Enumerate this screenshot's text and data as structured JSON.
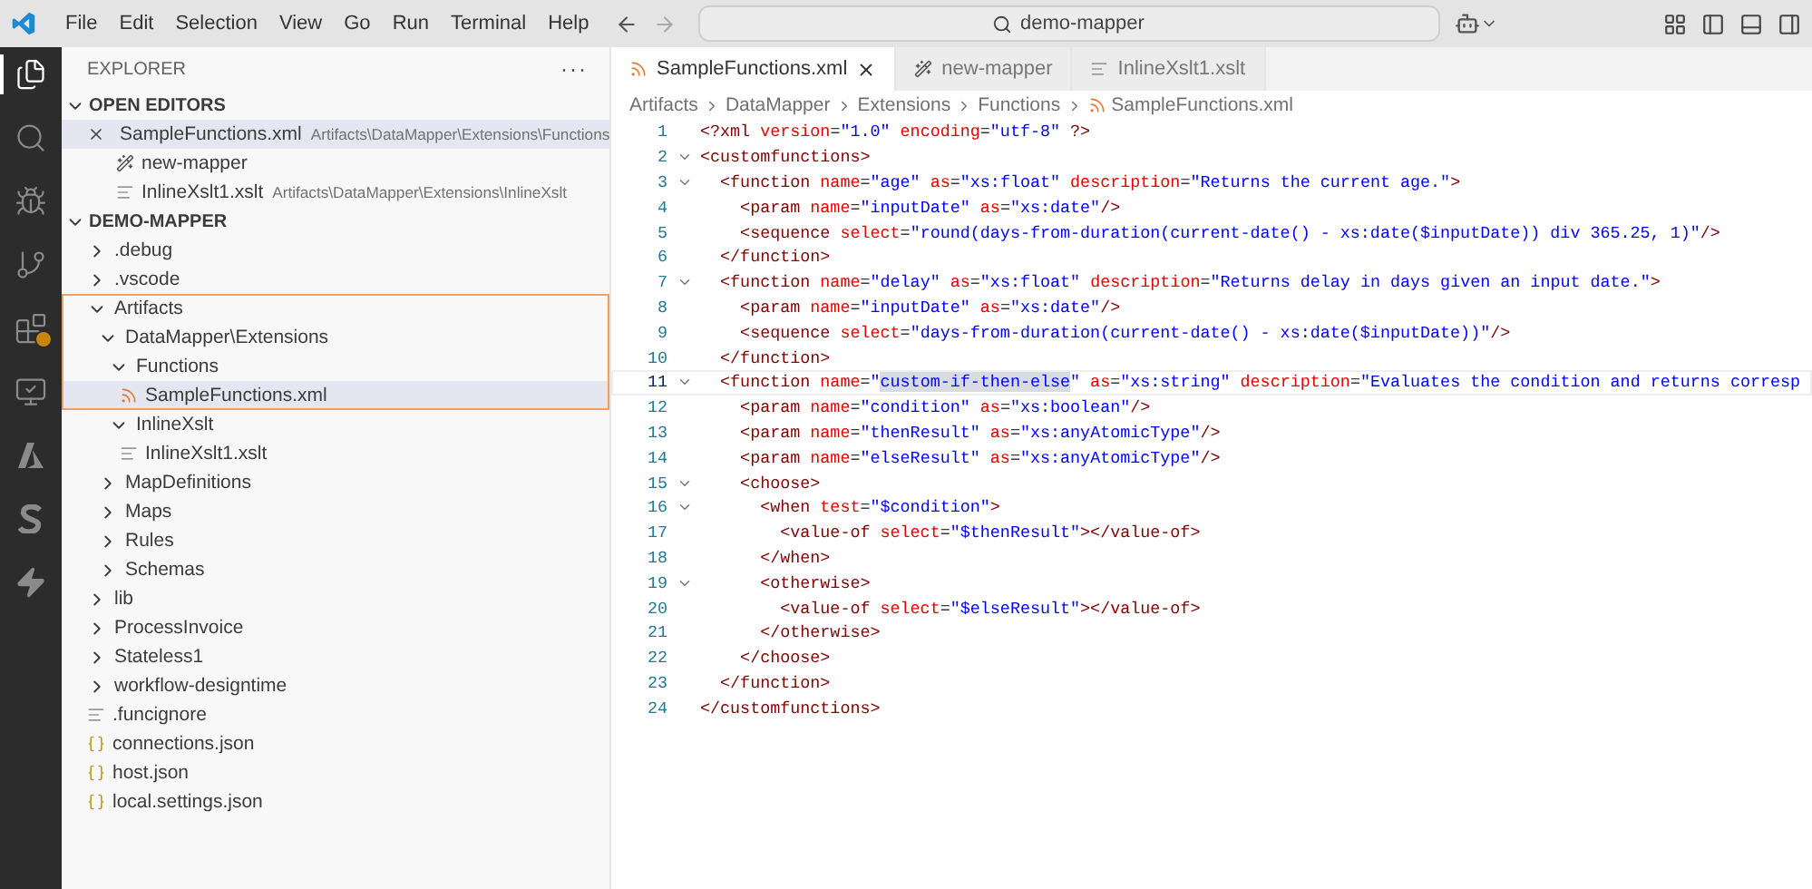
{
  "title_bar": {
    "menu": [
      "File",
      "Edit",
      "Selection",
      "View",
      "Go",
      "Run",
      "Terminal",
      "Help"
    ],
    "search": {
      "value": "demo-mapper"
    }
  },
  "activity_bar": [
    {
      "kind": "explorer",
      "selected": true
    },
    {
      "kind": "search",
      "selected": false
    },
    {
      "kind": "debug",
      "selected": false
    },
    {
      "kind": "git",
      "selected": false
    },
    {
      "kind": "extensions",
      "selected": false,
      "warning": true
    },
    {
      "kind": "remote",
      "selected": false
    },
    {
      "kind": "azure",
      "selected": false
    },
    {
      "kind": "sync",
      "selected": false
    },
    {
      "kind": "bolt",
      "selected": false
    }
  ],
  "explorer": {
    "title": "EXPLORER",
    "more": "···",
    "open_editors": {
      "title": "OPEN EDITORS",
      "expanded": true,
      "items": [
        {
          "name": "SampleFunctions.xml",
          "path": "Artifacts\\DataMapper\\Extensions\\Functions",
          "kind": "xml-file",
          "selected": true
        },
        {
          "name": "new-mapper",
          "kind": "mapper",
          "selected": false
        },
        {
          "name": "InlineXslt1.xslt",
          "path": "Artifacts\\DataMapper\\Extensions\\InlineXslt",
          "kind": "text-file",
          "selected": false
        }
      ]
    },
    "workspace": {
      "title": "DEMO-MAPPER",
      "expanded": true,
      "items": [
        {
          "name": ".debug",
          "kind": "folder",
          "expanded": false,
          "selected": false,
          "framed": false
        },
        {
          "name": ".vscode",
          "kind": "folder",
          "expanded": false,
          "selected": false,
          "framed": false
        },
        {
          "name": "Artifacts",
          "kind": "folder",
          "expanded": true,
          "selected": false,
          "framed": true,
          "children": [
            {
              "name": "DataMapper\\Extensions",
              "kind": "folder",
              "expanded": true,
              "selected": false,
              "framed": true,
              "children": [
                {
                  "name": "Functions",
                  "kind": "folder",
                  "expanded": true,
                  "selected": false,
                  "framed": true,
                  "children": [
                    {
                      "name": "SampleFunctions.xml",
                      "kind": "xml-file",
                      "selected": true,
                      "framed": true
                    }
                  ]
                },
                {
                  "name": "InlineXslt",
                  "kind": "folder",
                  "expanded": true,
                  "selected": false,
                  "framed": false,
                  "children": [
                    {
                      "name": "InlineXslt1.xslt",
                      "kind": "text-file",
                      "selected": false,
                      "framed": false
                    }
                  ]
                }
              ]
            },
            {
              "name": "MapDefinitions",
              "kind": "folder",
              "expanded": false,
              "selected": false,
              "framed": false
            },
            {
              "name": "Maps",
              "kind": "folder",
              "expanded": false,
              "selected": false,
              "framed": false
            },
            {
              "name": "Rules",
              "kind": "folder",
              "expanded": false,
              "selected": false,
              "framed": false
            },
            {
              "name": "Schemas",
              "kind": "folder",
              "expanded": false,
              "selected": false,
              "framed": false
            }
          ]
        },
        {
          "name": "lib",
          "kind": "folder",
          "expanded": false,
          "selected": false,
          "framed": false
        },
        {
          "name": "ProcessInvoice",
          "kind": "folder",
          "expanded": false,
          "selected": false,
          "framed": false
        },
        {
          "name": "Stateless1",
          "kind": "folder",
          "expanded": false,
          "selected": false,
          "framed": false
        },
        {
          "name": "workflow-designtime",
          "kind": "folder",
          "expanded": false,
          "selected": false,
          "framed": false
        },
        {
          "name": ".funcignore",
          "kind": "text-file",
          "selected": false,
          "framed": false
        },
        {
          "name": "connections.json",
          "kind": "json-file",
          "selected": false,
          "framed": false
        },
        {
          "name": "host.json",
          "kind": "json-file",
          "selected": false,
          "framed": false
        },
        {
          "name": "local.settings.json",
          "kind": "json-file",
          "selected": false,
          "framed": false
        }
      ]
    }
  },
  "tabs": [
    {
      "label": "SampleFunctions.xml",
      "kind": "xml-file",
      "selected": true
    },
    {
      "label": "new-mapper",
      "kind": "mapper",
      "selected": false
    },
    {
      "label": "InlineXslt1.xslt",
      "kind": "text-file",
      "selected": false
    }
  ],
  "breadcrumb": [
    {
      "label": "Artifacts",
      "kind": "folder"
    },
    {
      "label": "DataMapper",
      "kind": "folder"
    },
    {
      "label": "Extensions",
      "kind": "folder"
    },
    {
      "label": "Functions",
      "kind": "folder"
    },
    {
      "label": "SampleFunctions.xml",
      "kind": "xml-file"
    }
  ],
  "code": [
    {
      "number": "1",
      "foldable": false,
      "current": false,
      "tokens": [
        {
          "kind": "tag",
          "text": "<?xml"
        },
        {
          "kind": "attr",
          "text": " version"
        },
        {
          "kind": "punct",
          "text": "="
        },
        {
          "kind": "value",
          "text": "\"1.0\""
        },
        {
          "kind": "attr",
          "text": " encoding"
        },
        {
          "kind": "punct",
          "text": "="
        },
        {
          "kind": "value",
          "text": "\"utf-8\""
        },
        {
          "kind": "tag",
          "text": " ?>"
        }
      ]
    },
    {
      "number": "2",
      "foldable": true,
      "current": false,
      "tokens": [
        {
          "kind": "tag",
          "text": "<customfunctions>"
        }
      ]
    },
    {
      "number": "3",
      "foldable": true,
      "current": false,
      "tokens": [
        {
          "kind": "tag",
          "text": "  <function"
        },
        {
          "kind": "attr",
          "text": " name"
        },
        {
          "kind": "punct",
          "text": "="
        },
        {
          "kind": "value",
          "text": "\"age\""
        },
        {
          "kind": "attr",
          "text": " as"
        },
        {
          "kind": "punct",
          "text": "="
        },
        {
          "kind": "value",
          "text": "\"xs:float\""
        },
        {
          "kind": "attr",
          "text": " description"
        },
        {
          "kind": "punct",
          "text": "="
        },
        {
          "kind": "value",
          "text": "\"Returns the current age.\""
        },
        {
          "kind": "tag",
          "text": ">"
        }
      ]
    },
    {
      "number": "4",
      "foldable": false,
      "current": false,
      "tokens": [
        {
          "kind": "tag",
          "text": "    <param"
        },
        {
          "kind": "attr",
          "text": " name"
        },
        {
          "kind": "punct",
          "text": "="
        },
        {
          "kind": "value",
          "text": "\"inputDate\""
        },
        {
          "kind": "attr",
          "text": " as"
        },
        {
          "kind": "punct",
          "text": "="
        },
        {
          "kind": "value",
          "text": "\"xs:date\""
        },
        {
          "kind": "tag",
          "text": "/>"
        }
      ]
    },
    {
      "number": "5",
      "foldable": false,
      "current": false,
      "tokens": [
        {
          "kind": "tag",
          "text": "    <sequence"
        },
        {
          "kind": "attr",
          "text": " select"
        },
        {
          "kind": "punct",
          "text": "="
        },
        {
          "kind": "value",
          "text": "\"round(days-from-duration(current-date() - xs:date($inputDate)) div 365.25, 1)\""
        },
        {
          "kind": "tag",
          "text": "/>"
        }
      ]
    },
    {
      "number": "6",
      "foldable": false,
      "current": false,
      "tokens": [
        {
          "kind": "tag",
          "text": "  </function>"
        }
      ]
    },
    {
      "number": "7",
      "foldable": true,
      "current": false,
      "tokens": [
        {
          "kind": "tag",
          "text": "  <function"
        },
        {
          "kind": "attr",
          "text": " name"
        },
        {
          "kind": "punct",
          "text": "="
        },
        {
          "kind": "value",
          "text": "\"delay\""
        },
        {
          "kind": "attr",
          "text": " as"
        },
        {
          "kind": "punct",
          "text": "="
        },
        {
          "kind": "value",
          "text": "\"xs:float\""
        },
        {
          "kind": "attr",
          "text": " description"
        },
        {
          "kind": "punct",
          "text": "="
        },
        {
          "kind": "value",
          "text": "\"Returns delay in days given an input date.\""
        },
        {
          "kind": "tag",
          "text": ">"
        }
      ]
    },
    {
      "number": "8",
      "foldable": false,
      "current": false,
      "tokens": [
        {
          "kind": "tag",
          "text": "    <param"
        },
        {
          "kind": "attr",
          "text": " name"
        },
        {
          "kind": "punct",
          "text": "="
        },
        {
          "kind": "value",
          "text": "\"inputDate\""
        },
        {
          "kind": "attr",
          "text": " as"
        },
        {
          "kind": "punct",
          "text": "="
        },
        {
          "kind": "value",
          "text": "\"xs:date\""
        },
        {
          "kind": "tag",
          "text": "/>"
        }
      ]
    },
    {
      "number": "9",
      "foldable": false,
      "current": false,
      "tokens": [
        {
          "kind": "tag",
          "text": "    <sequence"
        },
        {
          "kind": "attr",
          "text": " select"
        },
        {
          "kind": "punct",
          "text": "="
        },
        {
          "kind": "value",
          "text": "\"days-from-duration(current-date() - xs:date($inputDate))\""
        },
        {
          "kind": "tag",
          "text": "/>"
        }
      ]
    },
    {
      "number": "10",
      "foldable": false,
      "current": false,
      "tokens": [
        {
          "kind": "tag",
          "text": "  </function>"
        }
      ]
    },
    {
      "number": "11",
      "foldable": true,
      "current": true,
      "tokens": [
        {
          "kind": "tag",
          "text": "  <function"
        },
        {
          "kind": "attr",
          "text": " name"
        },
        {
          "kind": "punct",
          "text": "="
        },
        {
          "kind": "value",
          "text": "\""
        },
        {
          "kind": "selected-value",
          "text": "custom-if-then-else"
        },
        {
          "kind": "value",
          "text": "\""
        },
        {
          "kind": "attr",
          "text": " as"
        },
        {
          "kind": "punct",
          "text": "="
        },
        {
          "kind": "value",
          "text": "\"xs:string\""
        },
        {
          "kind": "attr",
          "text": " description"
        },
        {
          "kind": "punct",
          "text": "="
        },
        {
          "kind": "value",
          "text": "\"Evaluates the condition and returns corresp"
        }
      ]
    },
    {
      "number": "12",
      "foldable": false,
      "current": false,
      "tokens": [
        {
          "kind": "tag",
          "text": "    <param"
        },
        {
          "kind": "attr",
          "text": " name"
        },
        {
          "kind": "punct",
          "text": "="
        },
        {
          "kind": "value",
          "text": "\"condition\""
        },
        {
          "kind": "attr",
          "text": " as"
        },
        {
          "kind": "punct",
          "text": "="
        },
        {
          "kind": "value",
          "text": "\"xs:boolean\""
        },
        {
          "kind": "tag",
          "text": "/>"
        }
      ]
    },
    {
      "number": "13",
      "foldable": false,
      "current": false,
      "tokens": [
        {
          "kind": "tag",
          "text": "    <param"
        },
        {
          "kind": "attr",
          "text": " name"
        },
        {
          "kind": "punct",
          "text": "="
        },
        {
          "kind": "value",
          "text": "\"thenResult\""
        },
        {
          "kind": "attr",
          "text": " as"
        },
        {
          "kind": "punct",
          "text": "="
        },
        {
          "kind": "value",
          "text": "\"xs:anyAtomicType\""
        },
        {
          "kind": "tag",
          "text": "/>"
        }
      ]
    },
    {
      "number": "14",
      "foldable": false,
      "current": false,
      "tokens": [
        {
          "kind": "tag",
          "text": "    <param"
        },
        {
          "kind": "attr",
          "text": " name"
        },
        {
          "kind": "punct",
          "text": "="
        },
        {
          "kind": "value",
          "text": "\"elseResult\""
        },
        {
          "kind": "attr",
          "text": " as"
        },
        {
          "kind": "punct",
          "text": "="
        },
        {
          "kind": "value",
          "text": "\"xs:anyAtomicType\""
        },
        {
          "kind": "tag",
          "text": "/>"
        }
      ]
    },
    {
      "number": "15",
      "foldable": true,
      "current": false,
      "tokens": [
        {
          "kind": "tag",
          "text": "    <choose>"
        }
      ]
    },
    {
      "number": "16",
      "foldable": true,
      "current": false,
      "tokens": [
        {
          "kind": "tag",
          "text": "      <when"
        },
        {
          "kind": "attr",
          "text": " test"
        },
        {
          "kind": "punct",
          "text": "="
        },
        {
          "kind": "value",
          "text": "\"$condition\""
        },
        {
          "kind": "tag",
          "text": ">"
        }
      ]
    },
    {
      "number": "17",
      "foldable": false,
      "current": false,
      "tokens": [
        {
          "kind": "tag",
          "text": "        <value-of"
        },
        {
          "kind": "attr",
          "text": " select"
        },
        {
          "kind": "punct",
          "text": "="
        },
        {
          "kind": "value",
          "text": "\"$thenResult\""
        },
        {
          "kind": "tag",
          "text": "></value-of>"
        }
      ]
    },
    {
      "number": "18",
      "foldable": false,
      "current": false,
      "tokens": [
        {
          "kind": "tag",
          "text": "      </when>"
        }
      ]
    },
    {
      "number": "19",
      "foldable": true,
      "current": false,
      "tokens": [
        {
          "kind": "tag",
          "text": "      <otherwise>"
        }
      ]
    },
    {
      "number": "20",
      "foldable": false,
      "current": false,
      "tokens": [
        {
          "kind": "tag",
          "text": "        <value-of"
        },
        {
          "kind": "attr",
          "text": " select"
        },
        {
          "kind": "punct",
          "text": "="
        },
        {
          "kind": "value",
          "text": "\"$elseResult\""
        },
        {
          "kind": "tag",
          "text": "></value-of>"
        }
      ]
    },
    {
      "number": "21",
      "foldable": false,
      "current": false,
      "tokens": [
        {
          "kind": "tag",
          "text": "      </otherwise>"
        }
      ]
    },
    {
      "number": "22",
      "foldable": false,
      "current": false,
      "tokens": [
        {
          "kind": "tag",
          "text": "    </choose>"
        }
      ]
    },
    {
      "number": "23",
      "foldable": false,
      "current": false,
      "tokens": [
        {
          "kind": "tag",
          "text": "  </function>"
        }
      ]
    },
    {
      "number": "24",
      "foldable": false,
      "current": false,
      "tokens": [
        {
          "kind": "tag",
          "text": "</customfunctions>"
        }
      ]
    }
  ]
}
